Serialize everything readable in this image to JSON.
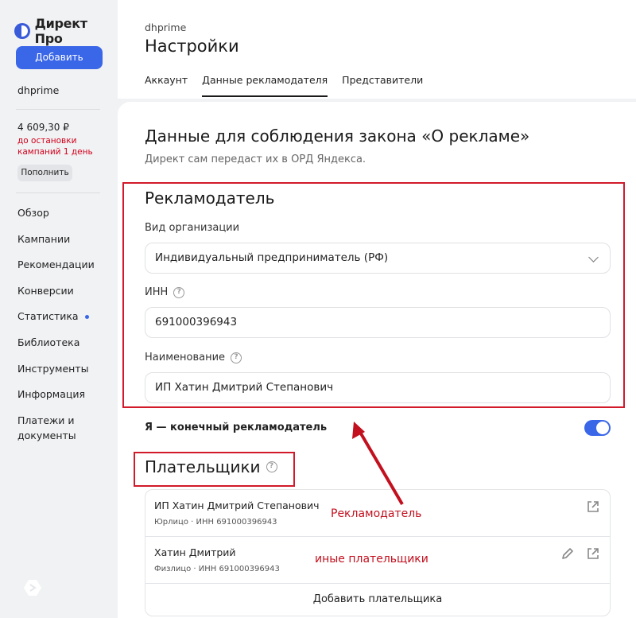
{
  "sidebar": {
    "logo_text": "Директ Про",
    "add_button": "Добавить",
    "account_name": "dhprime",
    "balance": "4 609,30 ₽",
    "balance_warning": "до остановки кампаний 1 день",
    "topup_button": "Пополнить",
    "nav": [
      {
        "label": "Обзор"
      },
      {
        "label": "Кампании"
      },
      {
        "label": "Рекомендации"
      },
      {
        "label": "Конверсии"
      },
      {
        "label": "Статистика"
      },
      {
        "label": "Библиотека"
      },
      {
        "label": "Инструменты"
      },
      {
        "label": "Информация"
      },
      {
        "label": "Платежи и документы"
      }
    ]
  },
  "header": {
    "breadcrumb": "dhprime",
    "title": "Настройки",
    "tabs": [
      {
        "label": "Аккаунт"
      },
      {
        "label": "Данные рекламодателя"
      },
      {
        "label": "Представители"
      }
    ],
    "active_tab": "Данные рекламодателя"
  },
  "main": {
    "section_title": "Данные для соблюдения закона «О рекламе»",
    "section_subtitle": "Директ сам передаст их в ОРД Яндекса.",
    "advertiser": {
      "title": "Рекламодатель",
      "org_type_label": "Вид организации",
      "org_type_value": "Индивидуальный предприниматель (РФ)",
      "inn_label": "ИНН",
      "inn_value": "691000396943",
      "name_label": "Наименование",
      "name_value": "ИП Хатин Дмитрий Степанович"
    },
    "final_advertiser_label": "Я — конечный рекламодатель",
    "final_advertiser_on": true,
    "payers": {
      "title": "Плательщики",
      "items": [
        {
          "name": "ИП Хатин Дмитрий Степанович",
          "meta": "Юрлицо · ИНН 691000396943"
        },
        {
          "name": "Хатин Дмитрий",
          "meta": "Физлицо · ИНН 691000396943"
        }
      ],
      "add_label": "Добавить плательщика"
    }
  },
  "annotations": {
    "advertiser_note": "Рекламодатель",
    "other_payers_note": "иные плательщики",
    "color": "#c2101e"
  },
  "colors": {
    "accent": "#3a66e8",
    "highlight": "#d11a2a"
  }
}
